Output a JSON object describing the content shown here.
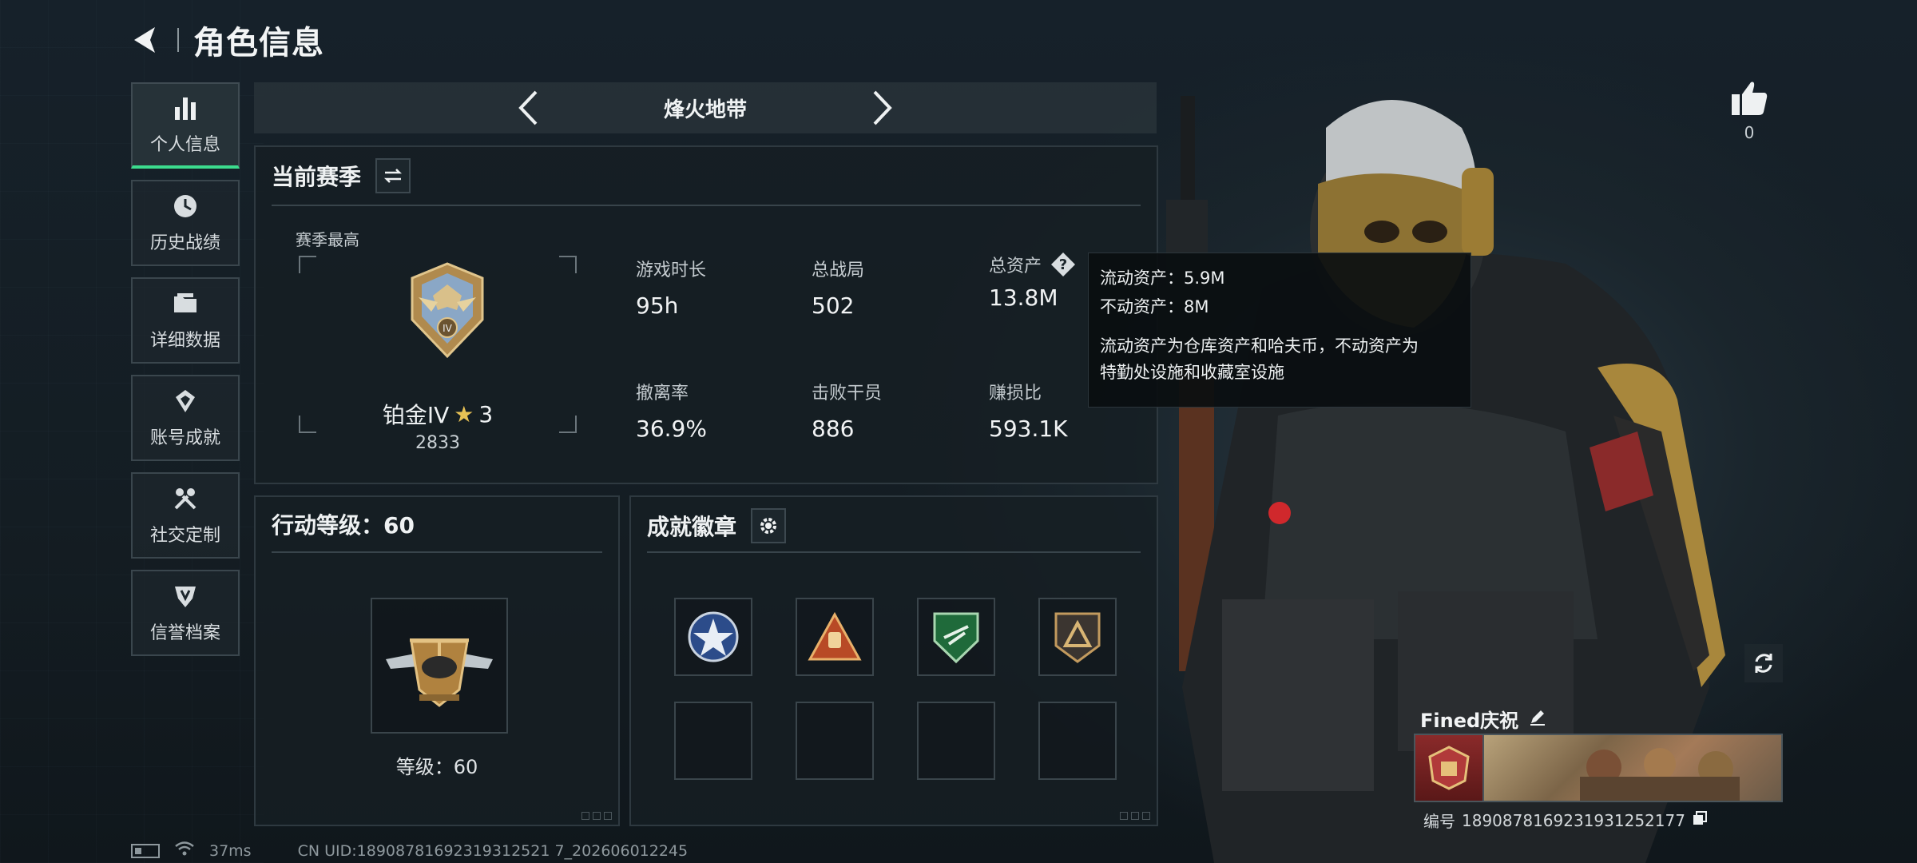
{
  "header": {
    "title": "角色信息"
  },
  "sidebar": {
    "items": [
      {
        "label": "个人信息",
        "icon": "bar-chart-icon",
        "active": true
      },
      {
        "label": "历史战绩",
        "icon": "clock-icon",
        "active": false
      },
      {
        "label": "详细数据",
        "icon": "folder-icon",
        "active": false
      },
      {
        "label": "账号成就",
        "icon": "achievement-icon",
        "active": false
      },
      {
        "label": "社交定制",
        "icon": "tools-icon",
        "active": false
      },
      {
        "label": "信誉档案",
        "icon": "shield-icon",
        "active": false
      }
    ]
  },
  "mode": {
    "name": "烽火地带"
  },
  "season": {
    "title": "当前赛季",
    "best_label": "赛季最高",
    "rank_name": "铂金IV",
    "rank_stars": "3",
    "rank_score": "2833",
    "stats": [
      {
        "label": "游戏时长",
        "value": "95h"
      },
      {
        "label": "总战局",
        "value": "502"
      },
      {
        "label": "总资产",
        "value": "13.8M"
      },
      {
        "label": "撤离率",
        "value": "36.9%"
      },
      {
        "label": "击败干员",
        "value": "886"
      },
      {
        "label": "赚损比",
        "value": "593.1K"
      }
    ]
  },
  "tooltip": {
    "liquid": "流动资产：5.9M",
    "fixed": "不动资产：8M",
    "desc_line1": "流动资产为仓库资产和哈夫币，不动资产为",
    "desc_line2": "特勤处设施和收藏室设施"
  },
  "action_level": {
    "title": "行动等级：60",
    "level_text": "等级：60"
  },
  "badges": {
    "title": "成就徽章",
    "slots": [
      "star-badge",
      "triangle-fist-badge",
      "green-shield-badge",
      "bronze-triangle-badge",
      "",
      "",
      "",
      ""
    ]
  },
  "profile": {
    "like_count": "0",
    "name": "Fined庆祝",
    "uid_label": "编号",
    "uid": "1890878169231931252177"
  },
  "status_bar": {
    "ping": "37ms",
    "cn_uid": "CN UID:18908781692319312521 7_202606012245"
  },
  "colors": {
    "accent_green": "#3cdc8e",
    "panel_border": "#2e3940"
  }
}
